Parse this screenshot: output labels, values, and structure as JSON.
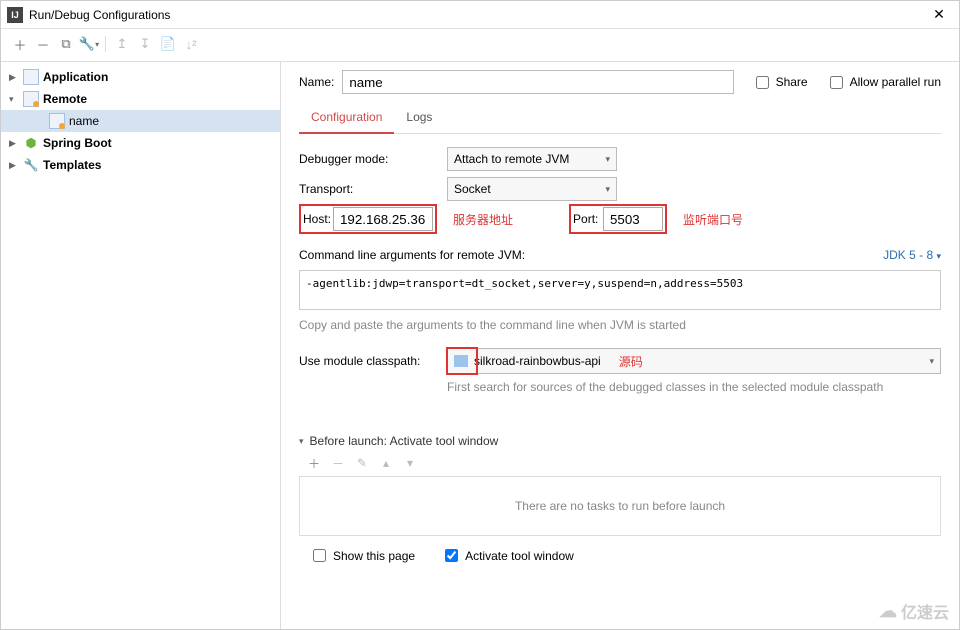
{
  "window": {
    "title": "Run/Debug Configurations"
  },
  "sidebar": {
    "items": [
      {
        "label": "Application"
      },
      {
        "label": "Remote"
      },
      {
        "label": "name"
      },
      {
        "label": "Spring Boot"
      },
      {
        "label": "Templates"
      }
    ]
  },
  "nameRow": {
    "label": "Name:",
    "value": "name",
    "share": "Share",
    "allowParallel": "Allow parallel run"
  },
  "tabs": {
    "configuration": "Configuration",
    "logs": "Logs"
  },
  "form": {
    "debuggerModeLabel": "Debugger mode:",
    "debuggerModeValue": "Attach to remote JVM",
    "transportLabel": "Transport:",
    "transportValue": "Socket",
    "hostLabel": "Host:",
    "hostValue": "192.168.25.36",
    "hostAnnotation": "服务器地址",
    "portLabel": "Port:",
    "portValue": "5503",
    "portAnnotation": "监听端口号",
    "cmdlineLabel": "Command line arguments for remote JVM:",
    "jdkLabel": "JDK 5 - 8",
    "cmdlineValue": "-agentlib:jdwp=transport=dt_socket,server=y,suspend=n,address=5503",
    "cmdlineHint": "Copy and paste the arguments to the command line when JVM is started",
    "moduleLabel": "Use module classpath:",
    "moduleValue": "silkroad-rainbowbus-api",
    "moduleAnnotation": "源码",
    "moduleHint": "First search for sources of the debugged classes in the selected module classpath"
  },
  "beforeLaunch": {
    "header": "Before launch: Activate tool window",
    "emptyText": "There are no tasks to run before launch",
    "showThisPage": "Show this page",
    "activateTool": "Activate tool window"
  },
  "watermark": "亿速云"
}
